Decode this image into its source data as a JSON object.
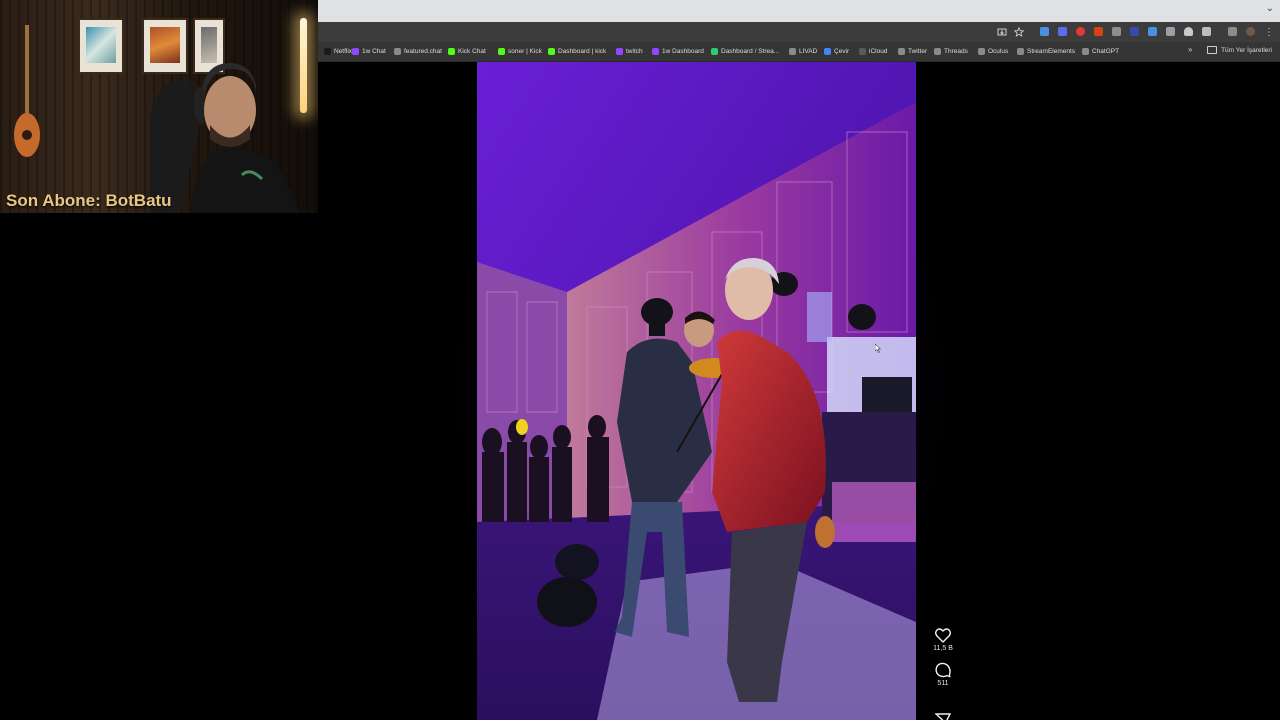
{
  "stream_overlay": {
    "last_subscriber": "Son Abone: BotBatu"
  },
  "bookmarks": [
    {
      "label": "Netflix",
      "color": "#1a1a1a"
    },
    {
      "label": "1w Chat",
      "color": "#9146ff"
    },
    {
      "label": "featured.chat",
      "color": "#8a8a8a"
    },
    {
      "label": "Kick Chat",
      "color": "#53fc18"
    },
    {
      "label": "soner | Kick",
      "color": "#53fc18"
    },
    {
      "label": "Dashboard | kick",
      "color": "#53fc18"
    },
    {
      "label": "twitch",
      "color": "#9146ff"
    },
    {
      "label": "1w Dashboard",
      "color": "#9146ff"
    },
    {
      "label": "Dashboard / Strea...",
      "color": "#2ecc71"
    },
    {
      "label": "LIVAD",
      "color": "#8a8a8a"
    },
    {
      "label": "Çevir",
      "color": "#4285f4"
    },
    {
      "label": "iCloud",
      "color": "#5a5a5a"
    },
    {
      "label": "Twitter",
      "color": "#8a8a8a"
    },
    {
      "label": "Threads",
      "color": "#8a8a8a"
    },
    {
      "label": "Oculus",
      "color": "#8a8a8a"
    },
    {
      "label": "StreamElements",
      "color": "#8a8a8a"
    },
    {
      "label": "ChatGPT",
      "color": "#8a8a8a"
    }
  ],
  "bookmarks_overflow": "»",
  "all_bookmarks": "Tüm Yer İşaretleri",
  "tabstrip_chevron": "⌄",
  "post": {
    "likes": "11,5 B",
    "comments": "511"
  },
  "icons": {
    "like": "heart-icon",
    "comment": "comment-icon",
    "share": "share-icon",
    "star": "bookmark-star-icon",
    "menu": "kebab-menu-icon"
  }
}
